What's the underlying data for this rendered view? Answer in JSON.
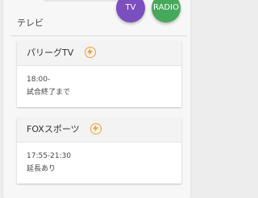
{
  "section": {
    "title": "テレビ"
  },
  "fabs": {
    "tv_label": "TV",
    "radio_label": "RADIO",
    "tv_color": "#7b4fbf",
    "radio_color": "#46a85b"
  },
  "cards": [
    {
      "channel": "パリーグTV",
      "icon": "flash-icon",
      "time": "18:00-",
      "note": "試合終了まで"
    },
    {
      "channel": "FOXスポーツ",
      "icon": "flash-icon",
      "time": "17:55-21:30",
      "note": "延長あり"
    }
  ],
  "colors": {
    "accent_icon": "#f0a030",
    "background": "#ededed"
  }
}
